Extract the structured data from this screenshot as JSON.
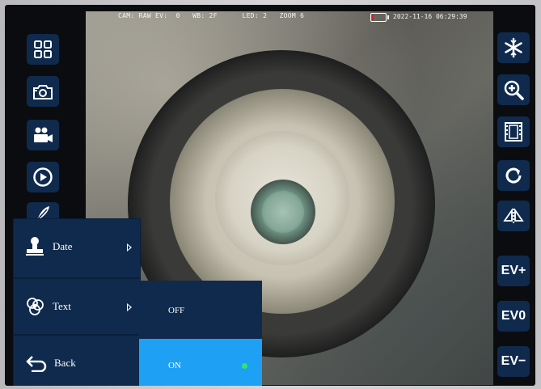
{
  "status_bar": {
    "overlay_text": "CAM: RAW EV:  0   WB: 2F      LED: 2   ZOOM 6",
    "datetime": "2022-11-16 06:29:39",
    "battery_level": 0.15
  },
  "left_toolbar": {
    "items": [
      {
        "name": "grid-icon"
      },
      {
        "name": "camera-icon"
      },
      {
        "name": "video-camera-icon"
      },
      {
        "name": "play-icon"
      },
      {
        "name": "feather-icon"
      }
    ]
  },
  "right_toolbar": {
    "items": [
      {
        "name": "snowflake-icon"
      },
      {
        "name": "zoom-in-icon"
      },
      {
        "name": "film-icon"
      },
      {
        "name": "rotate-icon"
      },
      {
        "name": "flip-icon"
      },
      {
        "label": "EV+"
      },
      {
        "label": "EV0"
      },
      {
        "label": "EV−"
      }
    ]
  },
  "menu": {
    "items": [
      {
        "label": "Date",
        "icon": "stamp-icon"
      },
      {
        "label": "Text",
        "icon": "palette-icon"
      },
      {
        "label": "Back",
        "icon": "back-arrow-icon"
      }
    ]
  },
  "submenu": {
    "options": [
      {
        "label": "OFF",
        "selected": false
      },
      {
        "label": "ON",
        "selected": true
      }
    ],
    "selected_color": "#1ea0f4"
  },
  "colors": {
    "button_bg": "#0f2a4d",
    "highlight": "#1ea0f4",
    "indicator": "#2ee66a",
    "battery": "#e11b22"
  }
}
